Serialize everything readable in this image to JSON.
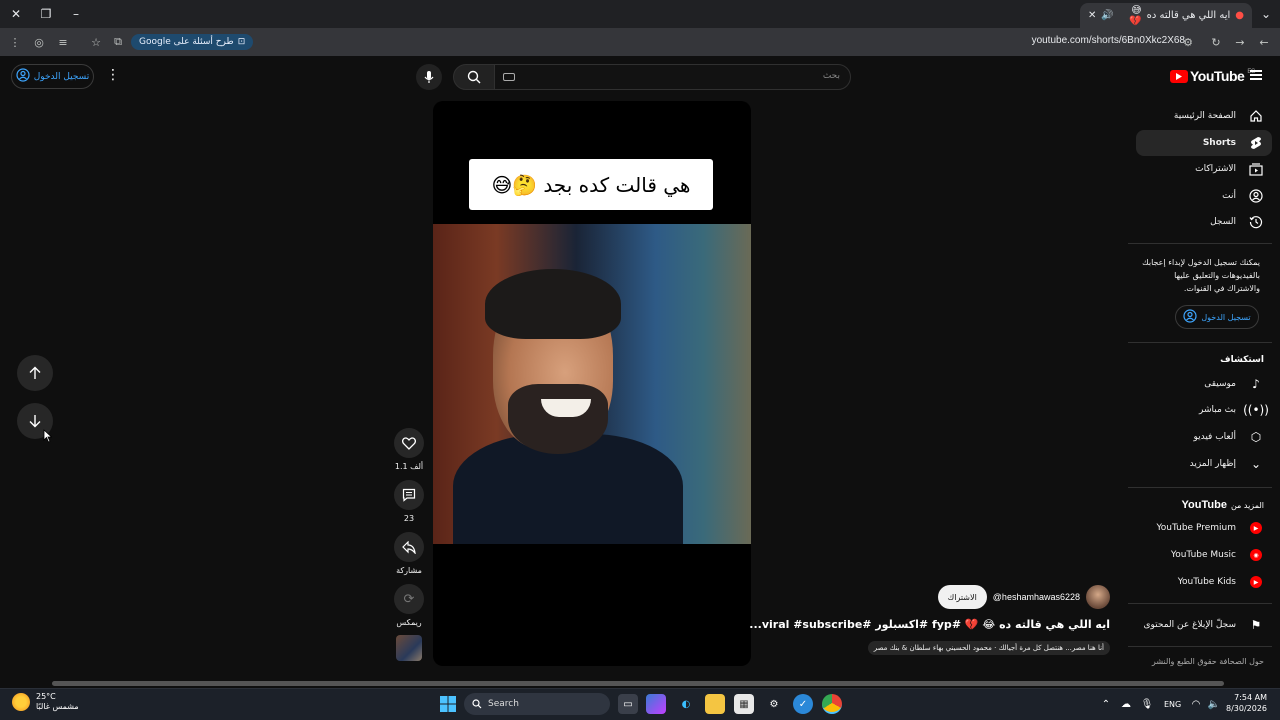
{
  "browser": {
    "tab_title": "ايه اللي هي قالته ده",
    "tab_emoji": "😅💔",
    "url": "youtube.com/shorts/6Bn0Xkc2X68",
    "google_pill": "طرح أسئلة على Google",
    "new_tab": "+"
  },
  "header": {
    "logo_text": "YouTube",
    "logo_region": "EG",
    "search_placeholder": "بحث",
    "signin_label": "تسجيل الدخول"
  },
  "sidebar": {
    "items": [
      {
        "label": "الصفحة الرئيسية",
        "icon": "home-icon"
      },
      {
        "label": "Shorts",
        "icon": "shorts-icon"
      },
      {
        "label": "الاشتراكات",
        "icon": "subscriptions-icon"
      },
      {
        "label": "أنت",
        "icon": "you-icon"
      },
      {
        "label": "السجل",
        "icon": "history-icon"
      }
    ],
    "signin_note": "يمكنك تسجيل الدخول لإبداء إعجابك بالفيديوهات والتعليق عليها والاشتراك في القنوات.",
    "signin_label": "تسجيل الدخول",
    "explore_title": "استكشاف",
    "explore": [
      {
        "label": "موسيقى",
        "icon": "music-icon"
      },
      {
        "label": "بث مباشر",
        "icon": "live-icon"
      },
      {
        "label": "ألعاب فيديو",
        "icon": "gaming-icon"
      },
      {
        "label": "إظهار المزيد",
        "icon": "chevron-down-icon"
      }
    ],
    "more_title_prefix": "المزيد من",
    "more_title_brand": "YouTube",
    "more": [
      {
        "label": "YouTube Premium"
      },
      {
        "label": "YouTube Music"
      },
      {
        "label": "YouTube Kids"
      }
    ],
    "report_label": "سجلّ الإبلاغ عن المحتوى",
    "footer": "حول الصحافة حقوق الطبع والنشر"
  },
  "video": {
    "caption": "هي قالت كده بجد",
    "caption_emoji": "🤔😅",
    "channel": "@heshamhawas6228",
    "subscribe_label": "الاشتراك",
    "title": "ايه اللي هي قالته ده 😂 💔 #fyp #اكسبلور #viral #subscribe...",
    "audio": "أنا هنا مصر... هنتصل كل مرة أجيالك · محمود الحسيني بهاء سلطان & بنك مصر",
    "likes": "1.1 ألف",
    "comments": "23",
    "share_label": "مشاركة",
    "remix_label": "ريمكس"
  },
  "taskbar": {
    "temp": "25°C",
    "weather": "مشمس غالبًا",
    "search": "Search",
    "lang": "ENG",
    "time": "7:54 AM",
    "date": "8/30/2026"
  }
}
